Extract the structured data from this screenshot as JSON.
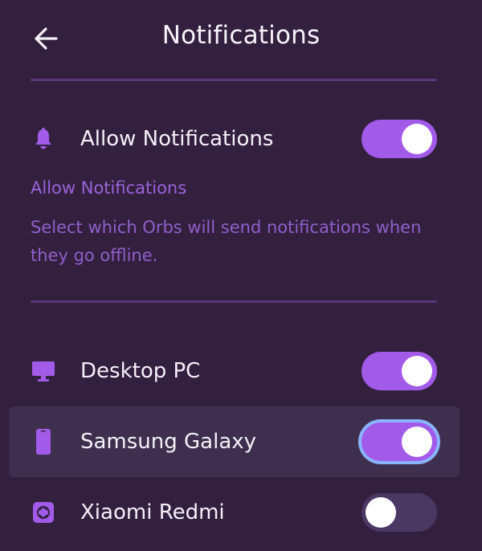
{
  "header": {
    "title": "Notifications",
    "back_icon": "arrow-left-icon"
  },
  "allow": {
    "label": "Allow Notifications",
    "icon": "bell-icon",
    "enabled": true
  },
  "section": {
    "subhead": "Allow Notifications",
    "description": "Select which Orbs will send notifications when they go offline."
  },
  "devices": [
    {
      "label": "Desktop PC",
      "icon": "monitor-icon",
      "enabled": true
    },
    {
      "label": "Samsung Galaxy",
      "icon": "phone-icon",
      "enabled": true,
      "focused": true
    },
    {
      "label": "Xiaomi Redmi",
      "icon": "tablet-icon",
      "enabled": false
    }
  ],
  "colors": {
    "background": "#33203f",
    "accent": "#a25ae8",
    "toggle_off": "#4a3862",
    "divider": "#55397a",
    "focus_ring": "#8ab4ff",
    "muted_text": "#9a63d9"
  }
}
